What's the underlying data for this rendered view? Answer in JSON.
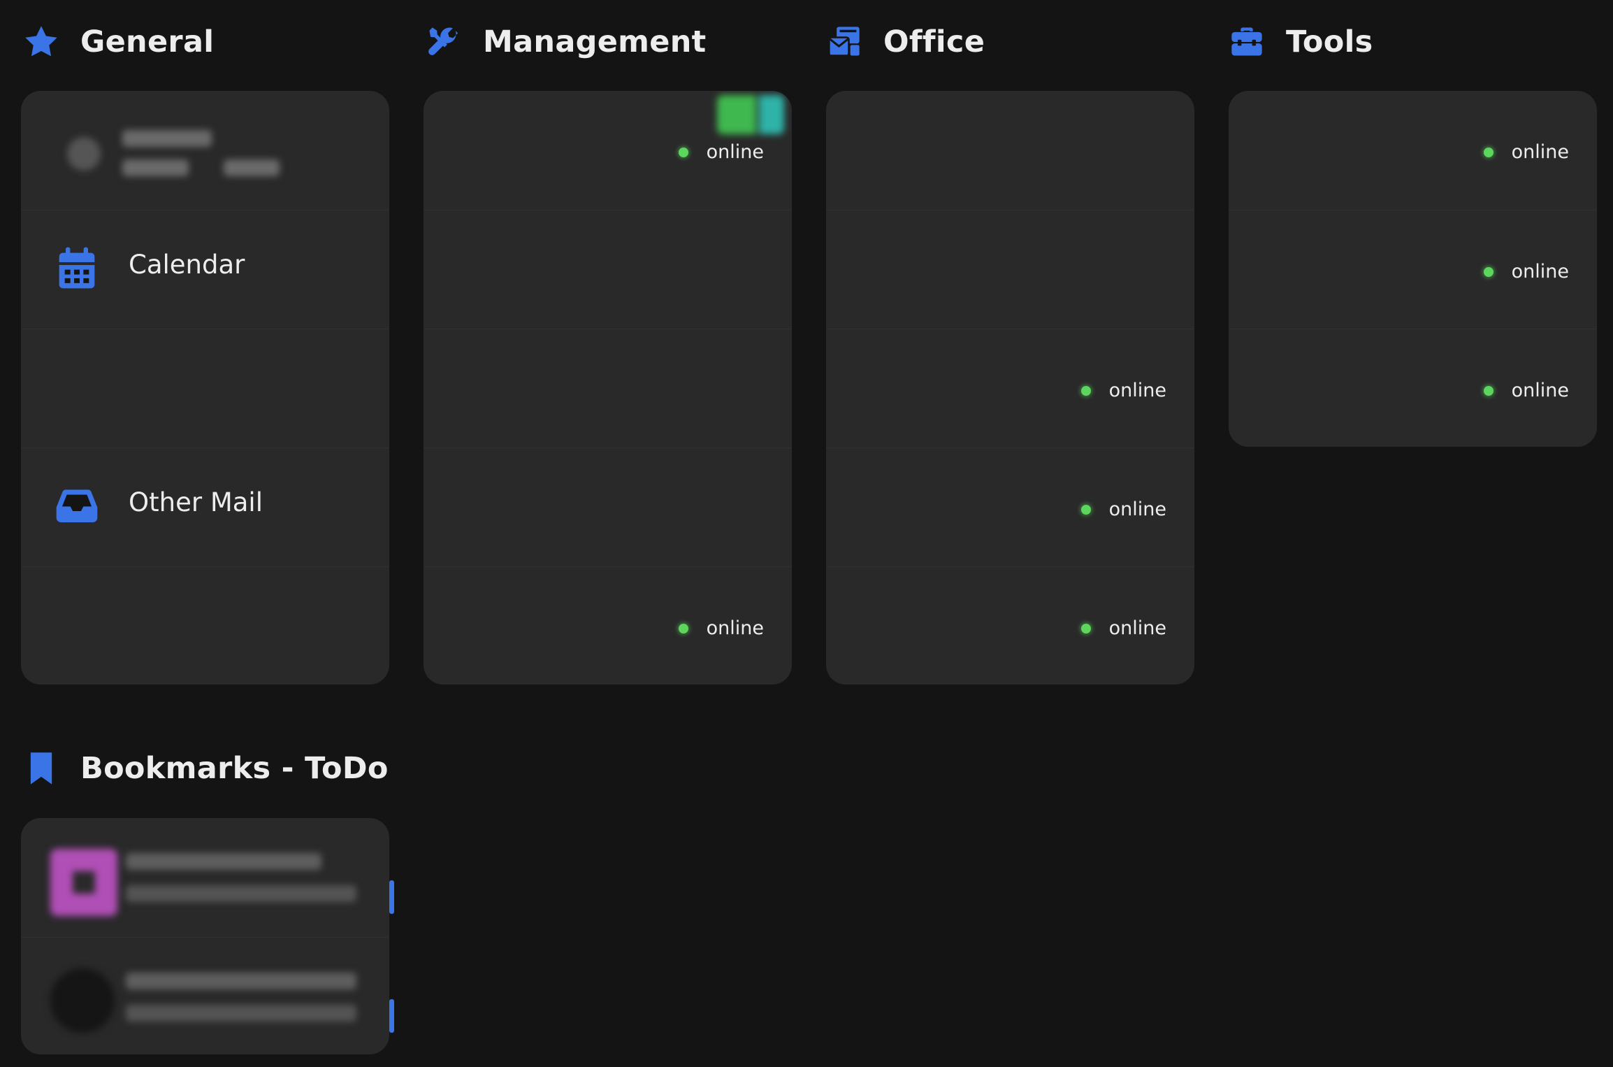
{
  "colors": {
    "background": "#141414",
    "card": "#292929",
    "accent": "#3b74e6",
    "status_online": "#5cd65c",
    "text": "#ededed"
  },
  "sections": {
    "general": {
      "title": "General",
      "icon": "star-icon"
    },
    "management": {
      "title": "Management",
      "icon": "tools-icon"
    },
    "office": {
      "title": "Office",
      "icon": "mail-bulk-icon"
    },
    "tools": {
      "title": "Tools",
      "icon": "toolbox-icon"
    },
    "bookmarks": {
      "title": "Bookmarks - ToDo",
      "icon": "bookmark-icon"
    }
  },
  "general_services": {
    "calendar": {
      "label": "Calendar",
      "icon": "calendar-icon"
    },
    "other_mail": {
      "label": "Other Mail",
      "icon": "inbox-icon"
    }
  },
  "status": {
    "online": "online"
  }
}
